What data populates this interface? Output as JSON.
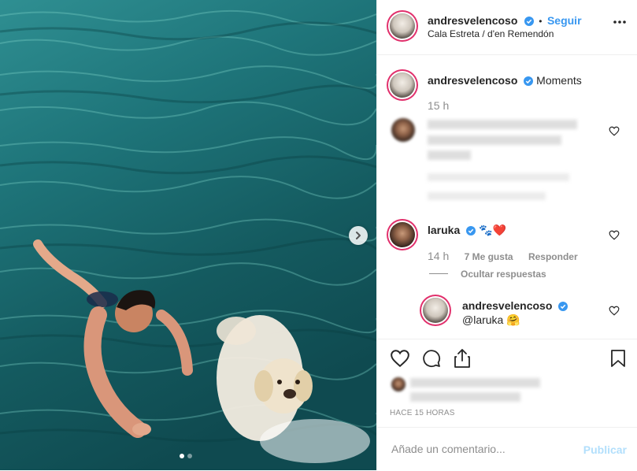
{
  "header": {
    "username": "andresvelencoso",
    "separator": "•",
    "follow_label": "Seguir",
    "location": "Cala Estreta / d'en Remendón"
  },
  "caption": {
    "username": "andresvelencoso",
    "text": "Moments",
    "time": "15 h"
  },
  "comments": [
    {
      "username": "laruka",
      "text": "🐾❤️",
      "time": "14 h",
      "likes": "7 Me gusta",
      "reply_label": "Responder",
      "hide_replies_label": "Ocultar respuestas",
      "replies": [
        {
          "username": "andresvelencoso",
          "text": "@laruka 🤗"
        }
      ]
    }
  ],
  "post_time": "HACE 15 HORAS",
  "comment_box": {
    "placeholder": "Añade un comentario...",
    "publish_label": "Publicar"
  },
  "carousel": {
    "total": 2,
    "current": 1
  },
  "colors": {
    "accent": "#3897f0",
    "verified": "#3897f0",
    "heart": "#ed4956"
  },
  "icons": [
    "more-icon",
    "heart-icon",
    "comment-icon",
    "share-icon",
    "bookmark-icon",
    "chevron-right-icon",
    "verified-icon"
  ]
}
